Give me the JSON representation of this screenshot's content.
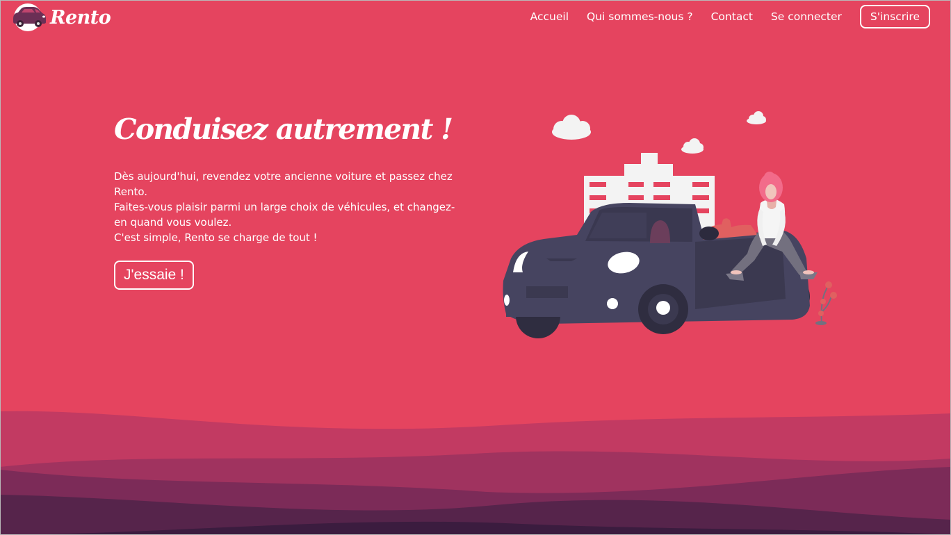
{
  "brand": {
    "name": "Rento",
    "logo_icon": "car-logo-icon"
  },
  "nav": {
    "items": [
      {
        "label": "Accueil"
      },
      {
        "label": "Qui sommes-nous ?"
      },
      {
        "label": "Contact"
      },
      {
        "label": "Se connecter"
      }
    ],
    "signup_label": "S'inscrire"
  },
  "hero": {
    "title": "Conduisez autrement !",
    "lines": [
      "Dès aujourd'hui, revendez votre ancienne voiture et passez chez Rento.",
      "Faites-vous plaisir parmi un large choix de véhicules, et changez-en quand vous voulez.",
      "C'est simple, Rento se charge de tout !"
    ],
    "cta_label": "J'essaie !"
  },
  "illustration": {
    "icon": "convertible-car-woman-illustration"
  },
  "colors": {
    "background": "#e5445f",
    "car_body": "#464460",
    "wave_1": "#c23a62",
    "wave_2": "#a0335f",
    "wave_3": "#7c2b58",
    "wave_4": "#56244b",
    "wave_5": "#3b1c3f",
    "text": "#ffffff"
  }
}
